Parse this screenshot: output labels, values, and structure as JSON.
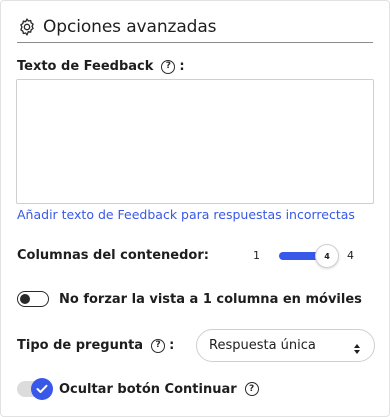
{
  "panel": {
    "title": "Opciones avanzadas",
    "title_icon": "gear-icon"
  },
  "feedback": {
    "label": "Texto de Feedback",
    "help_glyph": "?",
    "colon": ":",
    "value": "",
    "add_link": "Añadir texto de Feedback para respuestas incorrectas"
  },
  "columns": {
    "label": "Columnas del contenedor:",
    "min": "1",
    "max": "4",
    "value": "4"
  },
  "force_view": {
    "label": "No forzar la vista a 1 columna en móviles",
    "enabled": false
  },
  "question_type": {
    "label": "Tipo de pregunta",
    "help_glyph": "?",
    "colon": ":",
    "selected": "Respuesta única"
  },
  "hide_continue": {
    "label": "Ocultar botón Continuar",
    "help_glyph": "?",
    "enabled": true
  },
  "colors": {
    "accent": "#3858e9",
    "divider": "#8c8c8c",
    "border": "#cfcfcf"
  }
}
